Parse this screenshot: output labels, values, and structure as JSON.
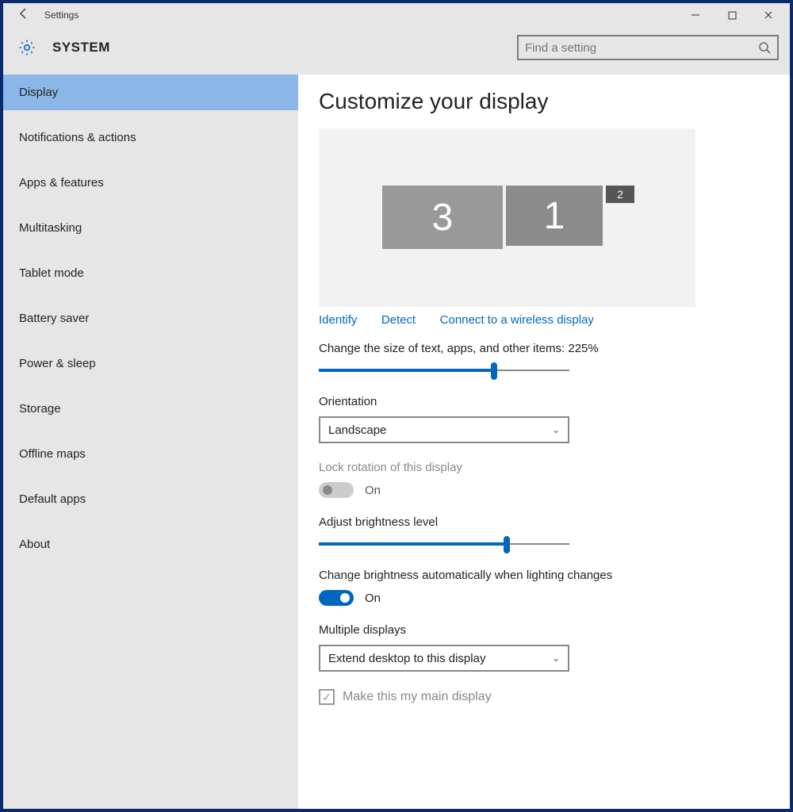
{
  "window": {
    "title": "Settings"
  },
  "header": {
    "section": "SYSTEM",
    "search_placeholder": "Find a setting"
  },
  "sidebar": {
    "items": [
      "Display",
      "Notifications & actions",
      "Apps & features",
      "Multitasking",
      "Tablet mode",
      "Battery saver",
      "Power & sleep",
      "Storage",
      "Offline maps",
      "Default apps",
      "About"
    ],
    "selected_index": 0
  },
  "content": {
    "title": "Customize your display",
    "monitors": {
      "m3": "3",
      "m1": "1",
      "m2": "2"
    },
    "links": {
      "identify": "Identify",
      "detect": "Detect",
      "wireless": "Connect to a wireless display"
    },
    "scale": {
      "label": "Change the size of text, apps, and other items: 225%",
      "fill_pct": 70
    },
    "orientation": {
      "label": "Orientation",
      "value": "Landscape"
    },
    "lock_rotation": {
      "label": "Lock rotation of this display",
      "state": "On"
    },
    "brightness": {
      "label": "Adjust brightness level",
      "fill_pct": 75
    },
    "auto_brightness": {
      "label": "Change brightness automatically when lighting changes",
      "state": "On"
    },
    "multiple_displays": {
      "label": "Multiple displays",
      "value": "Extend desktop to this display"
    },
    "main_display_checkbox": "Make this my main display"
  }
}
